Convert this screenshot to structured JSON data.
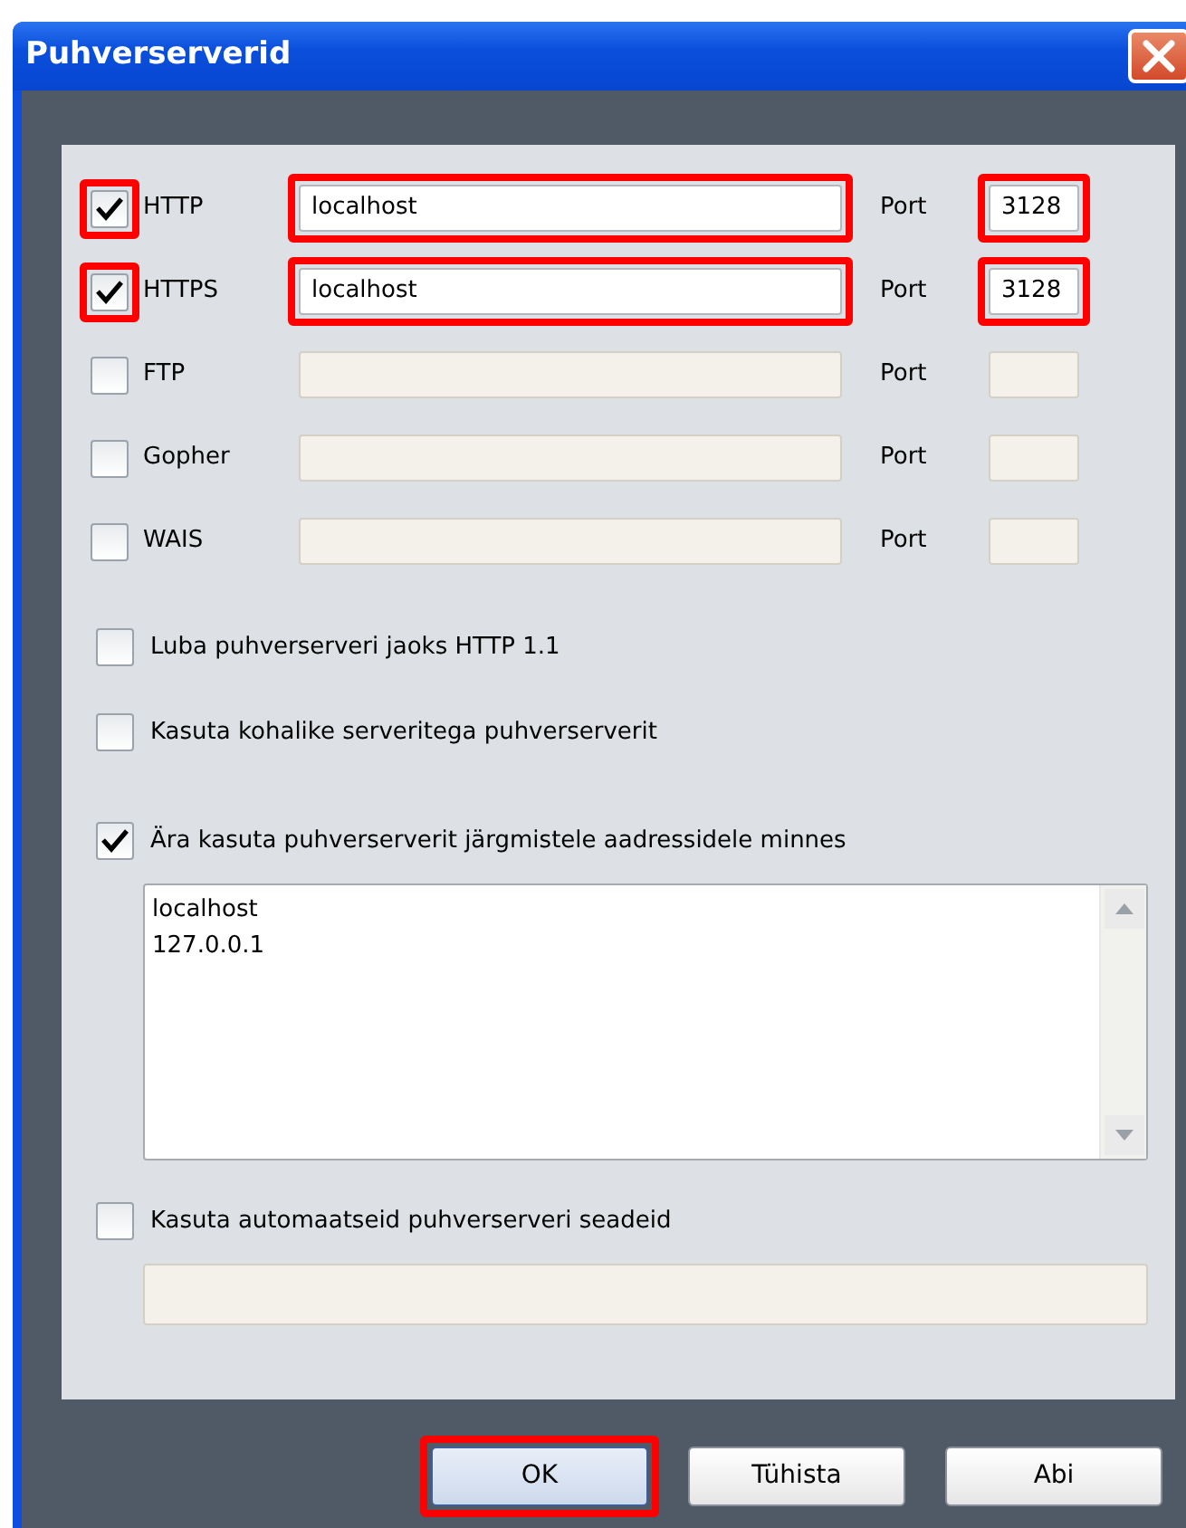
{
  "window": {
    "title": "Puhverserverid"
  },
  "proxies": [
    {
      "label": "HTTP",
      "checked": true,
      "host": "localhost",
      "port_label": "Port",
      "port": "3128",
      "highlighted": true
    },
    {
      "label": "HTTPS",
      "checked": true,
      "host": "localhost",
      "port_label": "Port",
      "port": "3128",
      "highlighted": true
    },
    {
      "label": "FTP",
      "checked": false,
      "port_label": "Port",
      "highlighted": false
    },
    {
      "label": "Gopher",
      "checked": false,
      "port_label": "Port",
      "highlighted": false
    },
    {
      "label": "WAIS",
      "checked": false,
      "port_label": "Port",
      "highlighted": false
    }
  ],
  "options": [
    {
      "label": "Luba puhverserveri jaoks HTTP 1.1",
      "checked": false
    },
    {
      "label": "Kasuta kohalike serveritega puhverserverit",
      "checked": false
    }
  ],
  "exceptions": {
    "label": "Ära kasuta puhverserverit järgmistele aadressidele minnes",
    "checked": true,
    "lines": [
      "localhost",
      "127.0.0.1"
    ]
  },
  "auto_config": {
    "label": "Kasuta automaatseid puhverserveri seadeid",
    "checked": false
  },
  "buttons": [
    {
      "label": "OK",
      "highlighted": true
    },
    {
      "label": "Tühista",
      "highlighted": false
    },
    {
      "label": "Abi",
      "highlighted": false
    }
  ]
}
